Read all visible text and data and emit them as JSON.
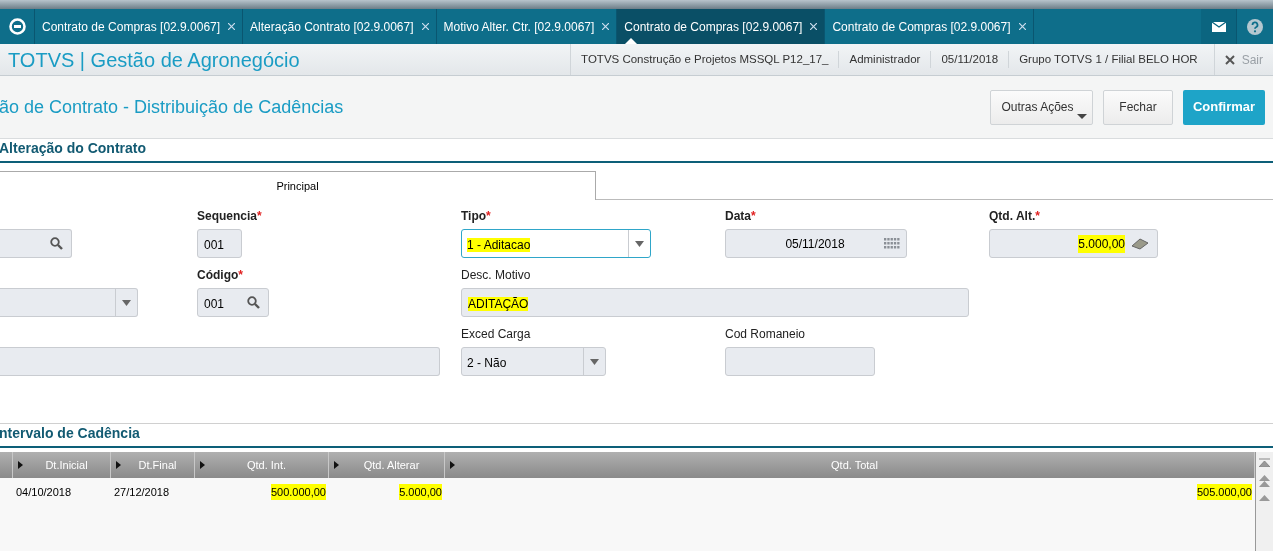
{
  "tabs": [
    {
      "label": "Contrato de Compras [02.9.0067]",
      "selected": false
    },
    {
      "label": "Alteração Contrato [02.9.0067]",
      "selected": false
    },
    {
      "label": "Motivo Alter. Ctr. [02.9.0067]",
      "selected": false
    },
    {
      "label": "Contrato de Compras [02.9.0067]",
      "selected": true
    },
    {
      "label": "Contrato de Compras [02.9.0067]",
      "selected": false
    }
  ],
  "header": {
    "brand": "TOTVS | Gestão de Agronegócio",
    "info": [
      "TOTVS Construção e Projetos MSSQL P12_17_",
      "Administrador",
      "05/11/2018",
      "Grupo TOTVS 1 / Filial BELO HOR"
    ],
    "exit": "Sair"
  },
  "page_title": "ão de Contrato - Distribuição de Cadências",
  "buttons": [
    {
      "label": "Outras Ações",
      "kind": "menu"
    },
    {
      "label": "Fechar",
      "kind": "plain"
    },
    {
      "label": "Confirmar",
      "kind": "primary"
    }
  ],
  "section_title": "Alteração do Contrato",
  "form_tabs": [
    {
      "label": "Principal",
      "selected": true
    }
  ],
  "form_rows": [
    [
      {
        "kind": "lookup"
      },
      {
        "kind": "text",
        "label": "Sequencia",
        "required_mark": "*",
        "value": "001",
        "highlighted": false
      },
      {
        "kind": "select",
        "label": "Tipo",
        "required_mark": "*",
        "value": "1 - Aditacao",
        "highlighted": true,
        "focused": true
      },
      {
        "kind": "date",
        "label": "Data",
        "required_mark": "*",
        "value": "05/11/2018",
        "highlighted": false
      },
      {
        "kind": "money",
        "label": "Qtd. Alt.",
        "required_mark": "*",
        "value": "5.000,00",
        "highlighted": true
      }
    ],
    [
      {
        "kind": "select"
      },
      {
        "kind": "lookup",
        "label": "Código",
        "required_mark": "*",
        "value": "001",
        "highlighted": false
      },
      {
        "kind": "wide",
        "label": "Desc. Motivo",
        "value": "ADITAÇÃO",
        "highlighted": true
      }
    ],
    [
      {
        "kind": "long"
      },
      {
        "kind": "select",
        "label": "Exced Carga",
        "value": "2 - Não",
        "highlighted": false,
        "focused": false
      },
      {
        "kind": "text",
        "label": "Cod Romaneio"
      }
    ]
  ],
  "grid_title": "ntervalo de Cadência",
  "grid": {
    "columns": [
      "Dt.Inicial",
      "Dt.Final",
      "Qtd. Int.",
      "Qtd. Alterar",
      "Qtd. Total"
    ],
    "rows": [
      {
        "cells": [
          {
            "text": "04/10/2018",
            "highlighted": false
          },
          {
            "text": "27/12/2018",
            "highlighted": false
          },
          {
            "text": "500.000,00",
            "highlighted": true
          },
          {
            "text": "5.000,00",
            "highlighted": true
          },
          {
            "text": "505.000,00",
            "highlighted": true
          }
        ]
      }
    ]
  }
}
